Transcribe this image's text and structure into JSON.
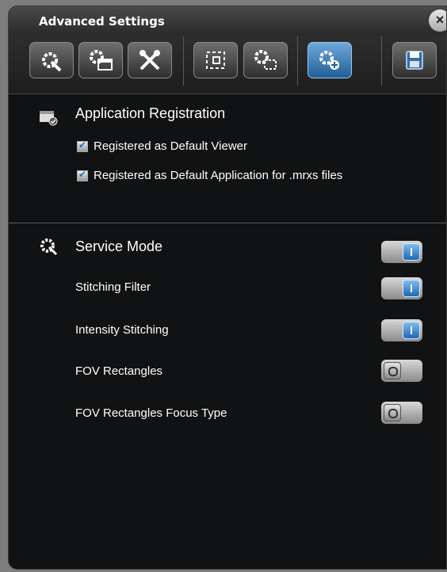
{
  "window": {
    "title": "Advanced Settings",
    "close_label": "×"
  },
  "toolbar": {
    "buttons": [
      {
        "icon": "gear-wrench-icon",
        "active": false
      },
      {
        "icon": "gear-window-icon",
        "active": false
      },
      {
        "icon": "tools-icon",
        "active": false
      },
      {
        "icon": "selection-icon",
        "active": false
      },
      {
        "icon": "gear-selection-icon",
        "active": false
      },
      {
        "icon": "gear-add-icon",
        "active": true
      },
      {
        "icon": "save-icon",
        "active": false
      }
    ]
  },
  "registration": {
    "heading": "Application Registration",
    "options": [
      {
        "label": "Registered as Default Viewer",
        "checked": true
      },
      {
        "label": "Registered as Default Application for .mrxs files",
        "checked": true
      }
    ]
  },
  "service": {
    "heading": "Service Mode",
    "heading_on": true,
    "items": [
      {
        "label": "Stitching Filter",
        "on": true
      },
      {
        "label": "Intensity Stitching",
        "on": true
      },
      {
        "label": "FOV Rectangles",
        "on": false
      },
      {
        "label": "FOV Rectangles Focus Type",
        "on": false
      }
    ]
  }
}
